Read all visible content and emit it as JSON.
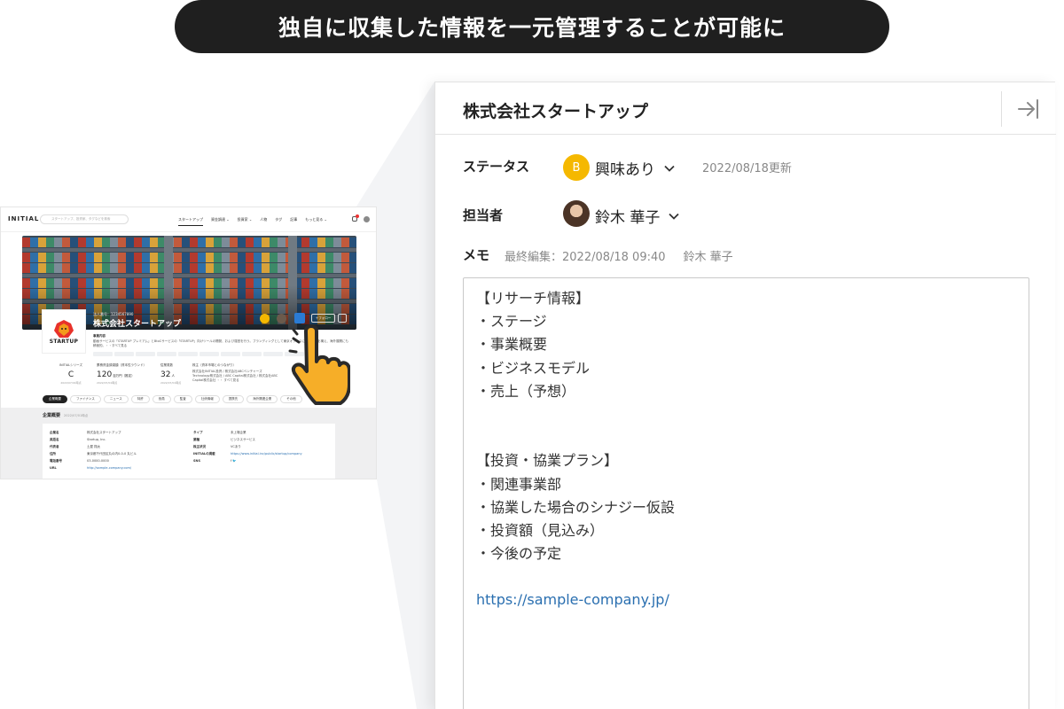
{
  "headline": "独自に収集した情報を一元管理することが可能に",
  "mini": {
    "logo": "INITIAL",
    "search_placeholder": "スタートアップ、投資家、タグなどを検索",
    "nav": [
      "スタートアップ",
      "資金調達 ⌄",
      "投資家 ⌄",
      "人物",
      "タグ",
      "記事",
      "もっと見る ⌄"
    ],
    "company_sub": "法人番号：1234567890",
    "company_name": "株式会社スタートアップ",
    "follow": "＋フォロー",
    "logo_text": "STARTUP",
    "desc_head": "事業内容",
    "desc": "動画サービスの「STARTUP プレミアム」とBtoCサービスの「STARTUP」向けツールの開発、および運営を行う。ブランディングとして東京オフィスにオフィスを構え、海外展開にも積極的。・・すべて見る",
    "stats": [
      {
        "label": "INITIALシリーズ",
        "value": "C",
        "sub": "2022/07/01時点"
      },
      {
        "label": "累積資金調達額（資本性ラウンド）",
        "value": "120",
        "unit": "百万円（推定）",
        "sub": "2022/07/01時点"
      },
      {
        "label": "従業員数",
        "value": "32",
        "unit": "人",
        "sub": "2022/07/01時点"
      },
      {
        "label": "株主（資本市場とのつながり）",
        "lines": [
          "株式会社INITIAL投資 / 株式会社ABCベンチャーズ",
          "Technology株式会社 / ABC Capital株式会社 / 株式会社ABC",
          "Capital株式会社 ・・ すべて見る"
        ]
      }
    ],
    "tabs": [
      "企業概要",
      "ファイナンス",
      "ニュース",
      "特許",
      "役員",
      "監査",
      "社債情報",
      "提携先",
      "海外関連企業",
      "その他"
    ],
    "overview_title": "企業概要",
    "overview_date": "2022/07/01時点",
    "left_fields": [
      {
        "k": "企業名",
        "v": "株式会社スタートアップ"
      },
      {
        "k": "英語名",
        "v": "Startup, Inc."
      },
      {
        "k": "代表者",
        "v": "土屋 翔太"
      },
      {
        "k": "住所",
        "v": "東京都千代田区丸の内0-0-0 丸ビル"
      },
      {
        "k": "電話番号",
        "v": "03-0000-0000"
      },
      {
        "k": "URL",
        "v": "http://sample-company.com/"
      }
    ],
    "right_fields": [
      {
        "k": "タイプ",
        "v": "未上場企業"
      },
      {
        "k": "業種",
        "v": "ビジネスサービス"
      },
      {
        "k": "株主状況",
        "v": "VCあり"
      },
      {
        "k": "INITIALの掲載",
        "v": "https://www.initial.inc/public/startup/company"
      },
      {
        "k": "SNS",
        "v": "f  🐦"
      }
    ]
  },
  "panel": {
    "title": "株式会社スタートアップ",
    "status_label": "ステータス",
    "status_badge": "B",
    "status_value": "興味あり",
    "status_updated": "2022/08/18更新",
    "assignee_label": "担当者",
    "assignee_name": "鈴木 華子",
    "memo_label": "メモ",
    "memo_last_edit": "最終編集：2022/08/18 09:40",
    "memo_editor": "鈴木 華子",
    "memo_lines": [
      "【リサーチ情報】",
      "・ステージ",
      "・事業概要",
      "・ビジネスモデル",
      "・売上（予想）",
      "",
      "",
      "【投資・協業プラン】",
      "・関連事業部",
      "・協業した場合のシナジー仮設",
      "・投資額（見込み）",
      "・今後の予定",
      "",
      "https://sample-company.jp/"
    ]
  },
  "colors": {
    "accent_yellow": "#f5b800",
    "link_blue": "#2a6fb0",
    "headline_bg": "#1f1f1f"
  },
  "icons": {
    "close_panel": "collapse-right-icon",
    "chevron": "chevron-down-icon",
    "pointer": "pointing-hand-icon"
  }
}
